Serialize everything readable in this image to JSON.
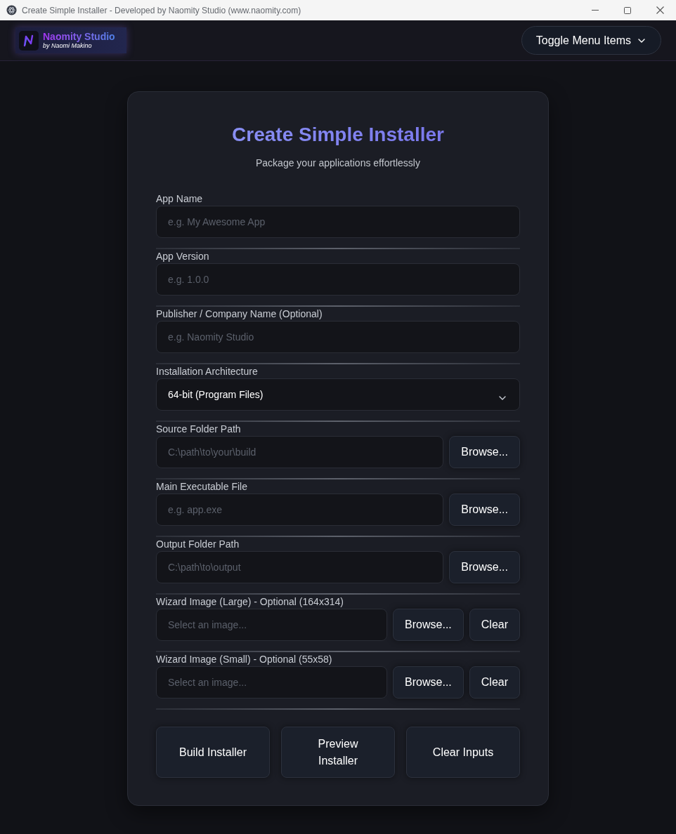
{
  "window": {
    "title": "Create Simple Installer - Developed by Naomity Studio (www.naomity.com)"
  },
  "header": {
    "logo": {
      "name": "Naomity Studio",
      "byline": "by Naomi Makino"
    },
    "menu_button": "Toggle Menu Items"
  },
  "form": {
    "title": "Create Simple Installer",
    "subtitle": "Package your applications effortlessly",
    "fields": [
      {
        "kind": "text",
        "label": "App Name",
        "placeholder": "e.g. My Awesome App"
      },
      {
        "kind": "text",
        "label": "App Version",
        "placeholder": "e.g. 1.0.0"
      },
      {
        "kind": "text",
        "label": "Publisher / Company Name (Optional)",
        "placeholder": "e.g. Naomity Studio"
      },
      {
        "kind": "select",
        "label": "Installation Architecture",
        "value": "64-bit (Program Files)"
      },
      {
        "kind": "text",
        "label": "Source Folder Path",
        "placeholder": "C:\\path\\to\\your\\build",
        "buttons": [
          "Browse..."
        ]
      },
      {
        "kind": "text",
        "label": "Main Executable File",
        "placeholder": "e.g. app.exe",
        "buttons": [
          "Browse..."
        ]
      },
      {
        "kind": "text",
        "label": "Output Folder Path",
        "placeholder": "C:\\path\\to\\output",
        "buttons": [
          "Browse..."
        ]
      },
      {
        "kind": "text",
        "label": "Wizard Image (Large) - Optional (164x314)",
        "placeholder": "Select an image...",
        "buttons": [
          "Browse...",
          "Clear"
        ]
      },
      {
        "kind": "text",
        "label": "Wizard Image (Small) - Optional (55x58)",
        "placeholder": "Select an image...",
        "buttons": [
          "Browse...",
          "Clear"
        ]
      }
    ],
    "actions": [
      "Build Installer",
      "Preview Installer",
      "Clear Inputs"
    ]
  }
}
